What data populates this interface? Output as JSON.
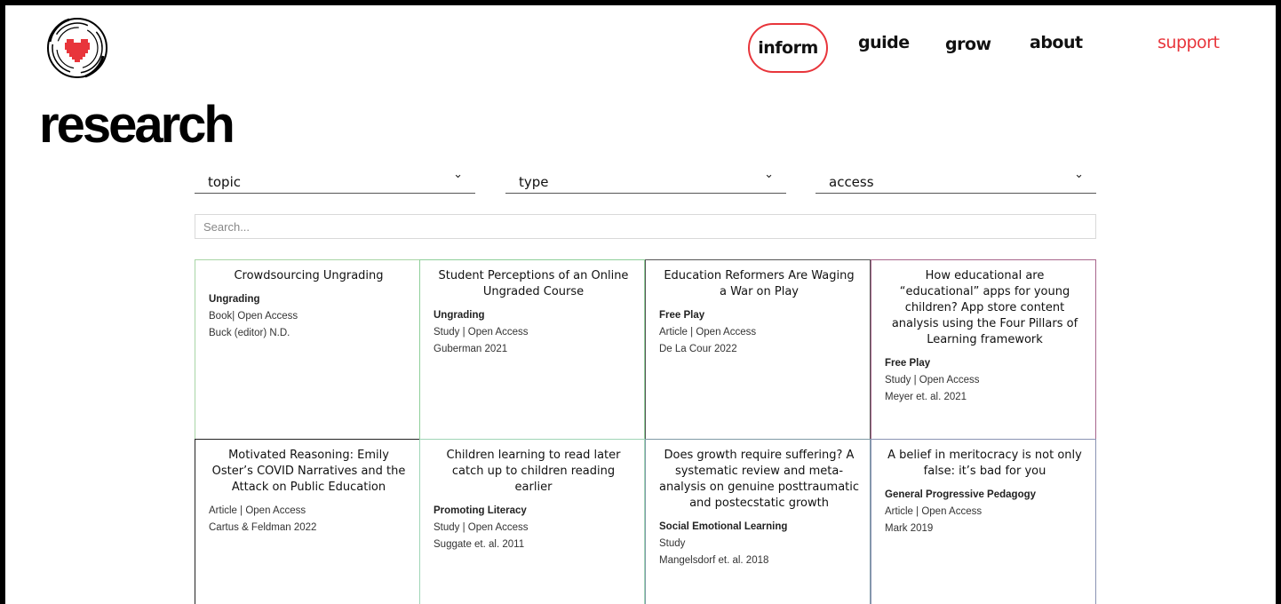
{
  "header": {
    "logo_icon": "pixel-heart-logo-icon",
    "nav": {
      "inform": "inform",
      "guide": "guide",
      "grow": "grow",
      "about": "about",
      "support": "support"
    },
    "accent_color": "#e8353b"
  },
  "page": {
    "title": "research"
  },
  "filters": {
    "topic": "topic",
    "type": "type",
    "access": "access",
    "chevron_icon": "chevron-down-icon"
  },
  "search": {
    "placeholder": "Search..."
  },
  "cards": [
    {
      "title": "Crowdsourcing Ungrading",
      "topic": "Ungrading",
      "type": "Book| Open Access",
      "author": "Buck (editor) N.D."
    },
    {
      "title": "Student Perceptions of an Online Ungraded Course",
      "topic": "Ungrading",
      "type": "Study | Open Access",
      "author": "Guberman 2021"
    },
    {
      "title": "Education Reformers Are Waging a War on Play",
      "topic": "Free Play",
      "type": "Article | Open Access",
      "author": "De La Cour 2022"
    },
    {
      "title": "How educational are “educational” apps for young children? App store content analysis using the Four Pillars of Learning framework",
      "topic": "Free Play",
      "type": "Study | Open Access",
      "author": "Meyer et. al. 2021"
    },
    {
      "title": "Motivated Reasoning: Emily Oster’s COVID Narratives and the Attack on Public Education",
      "topic": "",
      "type": "Article | Open Access",
      "author": "Cartus & Feldman 2022"
    },
    {
      "title": "Children learning to read later catch up to children reading earlier",
      "topic": "Promoting Literacy",
      "type": "Study | Open Access",
      "author": "Suggate et. al. 2011"
    },
    {
      "title": "Does growth require suffering? A systematic review and meta-analysis on genuine posttraumatic and postecstatic growth",
      "topic": "Social Emotional Learning",
      "type": "Study",
      "author": "Mangelsdorf et. al. 2018"
    },
    {
      "title": "A belief in meritocracy is not only false: it’s bad for you",
      "topic": "General Progressive Pedagogy",
      "type": "Article | Open Access",
      "author": "Mark 2019"
    }
  ]
}
